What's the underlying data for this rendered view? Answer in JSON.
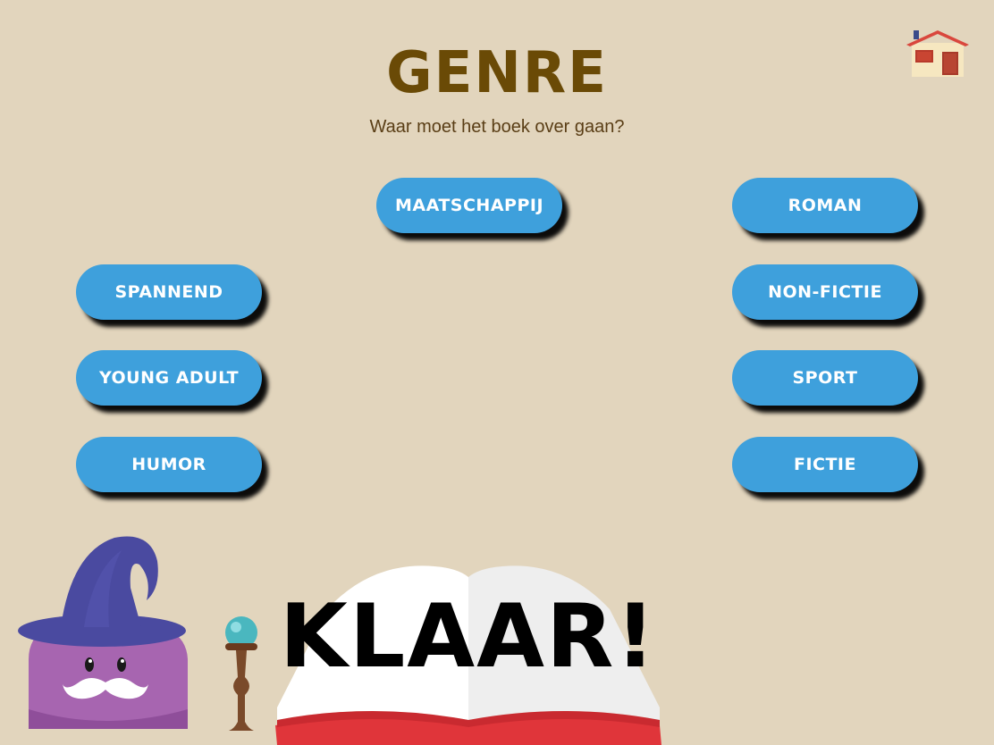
{
  "header": {
    "title": "GENRE",
    "subtitle": "Waar moet het boek over gaan?"
  },
  "icons": {
    "home": "home-icon",
    "wizard": "wizard-mascot",
    "staff": "magic-staff",
    "book": "open-book"
  },
  "genres": {
    "maatschappij": "MAATSCHAPPIJ",
    "roman": "ROMAN",
    "spannend": "SPANNEND",
    "non_fictie": "NON-FICTIE",
    "young_adult": "YOUNG ADULT",
    "sport": "SPORT",
    "humor": "HUMOR",
    "fictie": "FICTIE"
  },
  "done": {
    "label": "KLAAR!"
  },
  "colors": {
    "background": "#e2d5bd",
    "title": "#6a4a06",
    "button": "#3ea0dc",
    "wizard_hat": "#4a4aa0",
    "wizard_body": "#a765b0",
    "book_cover": "#e0353a"
  }
}
